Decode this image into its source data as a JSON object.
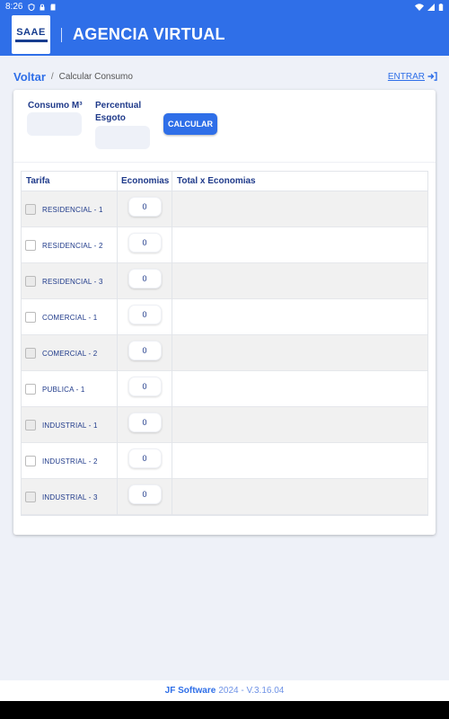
{
  "status_bar": {
    "time": "8:26",
    "icons": [
      "shield-icon",
      "lock-icon",
      "sd-card-icon"
    ],
    "right_icons": [
      "wifi-icon",
      "signal-icon",
      "battery-icon"
    ]
  },
  "app_bar": {
    "logo_text": "SAAE",
    "title": "AGENCIA VIRTUAL"
  },
  "breadcrumb": {
    "back": "Voltar",
    "separator": "/",
    "current": "Calcular Consumo",
    "login": "ENTRAR"
  },
  "form": {
    "consumo_label": "Consumo M³",
    "consumo_value": "",
    "percentual_label_line1": "Percentual",
    "percentual_label_line2": "Esgoto",
    "percentual_value": "",
    "calcular_label": "CALCULAR"
  },
  "table": {
    "headers": [
      "Tarifa",
      "Economias",
      "Total x Economias"
    ],
    "rows": [
      {
        "tarifa": "RESIDENCIAL - 1",
        "economias": "0",
        "total": ""
      },
      {
        "tarifa": "RESIDENCIAL - 2",
        "economias": "0",
        "total": ""
      },
      {
        "tarifa": "RESIDENCIAL - 3",
        "economias": "0",
        "total": ""
      },
      {
        "tarifa": "COMERCIAL - 1",
        "economias": "0",
        "total": ""
      },
      {
        "tarifa": "COMERCIAL - 2",
        "economias": "0",
        "total": ""
      },
      {
        "tarifa": "PUBLICA - 1",
        "economias": "0",
        "total": ""
      },
      {
        "tarifa": "INDUSTRIAL - 1",
        "economias": "0",
        "total": ""
      },
      {
        "tarifa": "INDUSTRIAL - 2",
        "economias": "0",
        "total": ""
      },
      {
        "tarifa": "INDUSTRIAL - 3",
        "economias": "0",
        "total": ""
      }
    ]
  },
  "footer": {
    "brand": "JF Software",
    "version": "2024 - V.3.16.04"
  },
  "colors": {
    "primary": "#2f6fe8",
    "text": "#1f3a8a",
    "background": "#eef1f8"
  }
}
